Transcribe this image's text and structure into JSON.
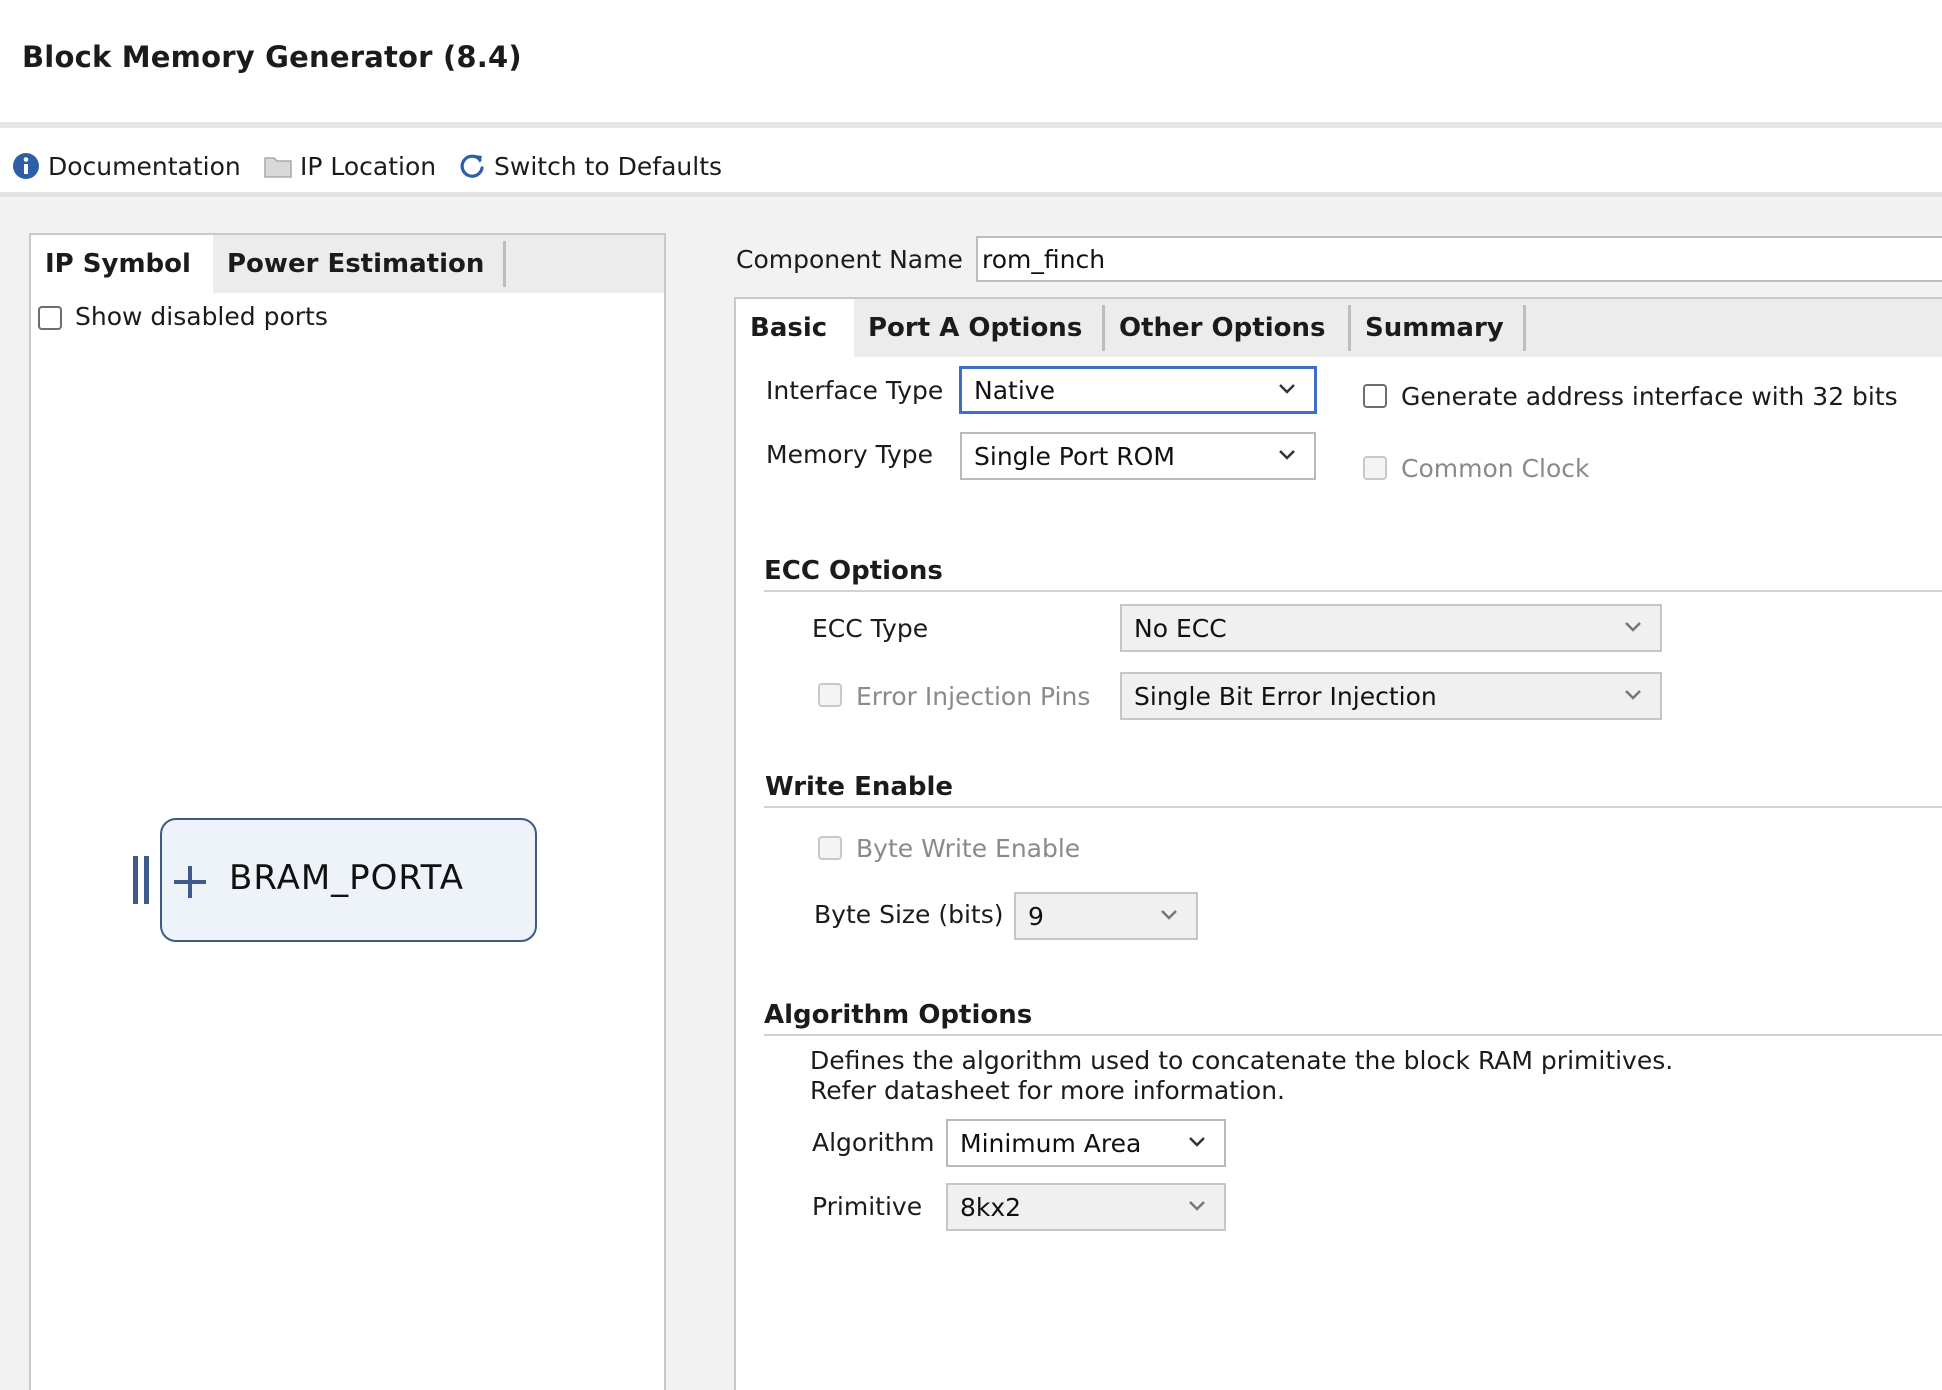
{
  "app": {
    "title": "Block Memory Generator (8.4)"
  },
  "toolbar": {
    "documentation": "Documentation",
    "ip_location": "IP Location",
    "switch_defaults": "Switch to Defaults"
  },
  "left": {
    "tabs": [
      "IP Symbol",
      "Power Estimation"
    ],
    "show_disabled_ports": "Show disabled ports",
    "symbol_port": "BRAM_PORTA"
  },
  "component": {
    "label": "Component Name",
    "value": "rom_finch"
  },
  "tabs": [
    "Basic",
    "Port A Options",
    "Other Options",
    "Summary"
  ],
  "basic": {
    "interface_type_label": "Interface Type",
    "interface_type_value": "Native",
    "memory_type_label": "Memory Type",
    "memory_type_value": "Single Port ROM",
    "gen_addr_32": "Generate address interface with 32 bits",
    "common_clock": "Common Clock"
  },
  "ecc": {
    "title": "ECC Options",
    "type_label": "ECC Type",
    "type_value": "No ECC",
    "error_injection_label": "Error Injection Pins",
    "error_injection_value": "Single Bit Error Injection"
  },
  "write_enable": {
    "title": "Write Enable",
    "byte_write_enable": "Byte Write Enable",
    "byte_size_label": "Byte Size (bits)",
    "byte_size_value": "9"
  },
  "algorithm": {
    "title": "Algorithm Options",
    "desc_line1": "Defines the algorithm used to concatenate the block RAM primitives.",
    "desc_line2": "Refer datasheet for more information.",
    "algorithm_label": "Algorithm",
    "algorithm_value": "Minimum Area",
    "primitive_label": "Primitive",
    "primitive_value": "8kx2"
  },
  "colors": {
    "accent": "#3f6fc4",
    "info_icon": "#2d5fa8",
    "symbol_border": "#3d5a8a"
  }
}
